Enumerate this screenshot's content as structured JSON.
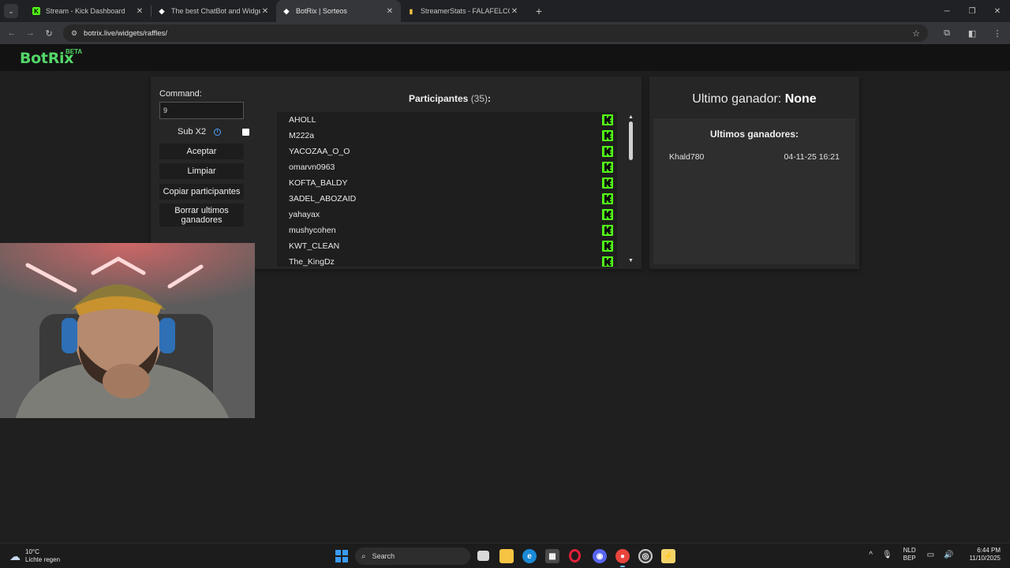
{
  "browser": {
    "tabs": [
      {
        "title": "Stream - Kick Dashboard",
        "icon": "kick-icon",
        "active": false
      },
      {
        "title": "The best ChatBot and Widgets",
        "icon": "botrix-icon",
        "active": false
      },
      {
        "title": "BotRix | Sorteos",
        "icon": "botrix-icon",
        "active": true
      },
      {
        "title": "StreamerStats - FALAFELCO Pro",
        "icon": "stats-icon",
        "active": false
      }
    ],
    "url": "botrix.live/widgets/raffles/"
  },
  "site": {
    "logo": "BotRix",
    "badge": "BETA"
  },
  "controls": {
    "command_label": "Command:",
    "command_value": "9",
    "sub_x2_label": "Sub X2",
    "sub_x2_checked": false,
    "accept_label": "Aceptar",
    "clear_label": "Limpiar",
    "copy_label": "Copiar participantes",
    "delete_label": "Borrar ultimos ganadores"
  },
  "participants": {
    "title": "Participantes",
    "count": "(35)",
    "suffix": ":",
    "list": [
      {
        "name": "AHOLL",
        "platform": "kick"
      },
      {
        "name": "M222a",
        "platform": "kick"
      },
      {
        "name": "YACOZAA_O_O",
        "platform": "kick"
      },
      {
        "name": "omarvn0963",
        "platform": "kick"
      },
      {
        "name": "KOFTA_BALDY",
        "platform": "kick"
      },
      {
        "name": "3ADEL_ABOZAID",
        "platform": "kick"
      },
      {
        "name": "yahayax",
        "platform": "kick"
      },
      {
        "name": "mushycohen",
        "platform": "kick"
      },
      {
        "name": "KWT_CLEAN",
        "platform": "kick"
      },
      {
        "name": "The_KingDz",
        "platform": "kick"
      }
    ]
  },
  "winner": {
    "last_label": "Ultimo ganador:",
    "last_value": "None",
    "history_title": "Ultimos ganadores:",
    "history": [
      {
        "name": "Khald780",
        "date": "04-11-25 16:21"
      }
    ]
  },
  "taskbar": {
    "weather_temp": "10°C",
    "weather_condition": "Lichte regen",
    "search_placeholder": "Search",
    "lang_1": "NLD",
    "lang_2": "BEP",
    "time": "6:44 PM",
    "date": "11/10/2025"
  },
  "colors": {
    "accent_green": "#53d769",
    "kick_green": "#53fc18",
    "panel": "#262626",
    "background": "#1f1f1f"
  }
}
